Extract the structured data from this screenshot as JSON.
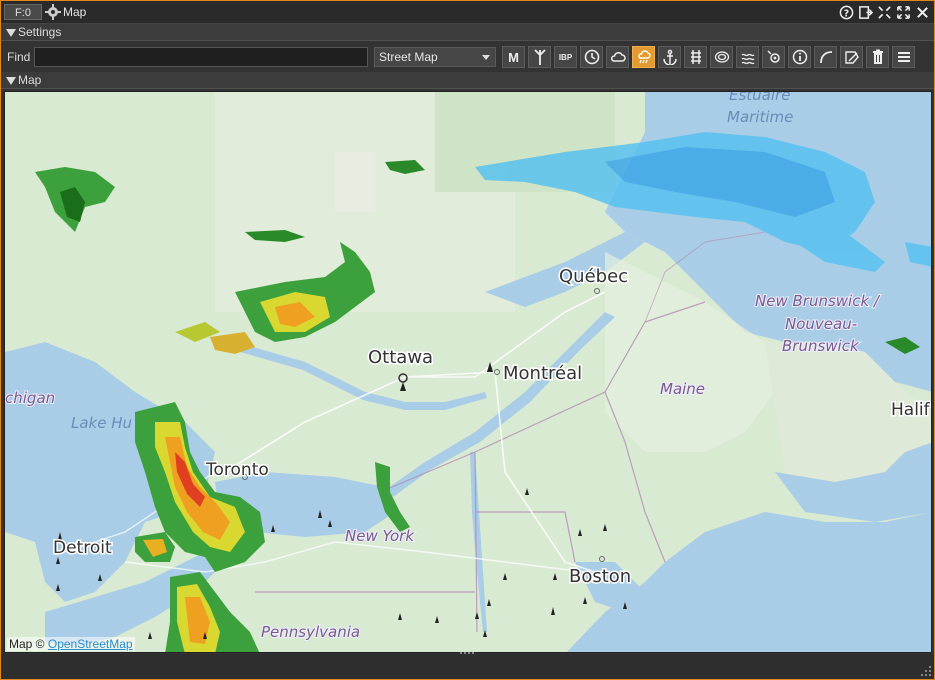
{
  "titlebar": {
    "badge": "F:0",
    "title": "Map"
  },
  "settings_section": {
    "label": "Settings"
  },
  "toolbar": {
    "find_label": "Find",
    "find_value": "",
    "map_style": "Street Map",
    "btn_m": "M",
    "btn_ibp": "IBP"
  },
  "map_section": {
    "label": "Map"
  },
  "map": {
    "cities": {
      "quebec": "Québec",
      "ottawa": "Ottawa",
      "montreal": "Montréal",
      "toronto": "Toronto",
      "detroit": "Detroit",
      "boston": "Boston",
      "halifax": "Halif"
    },
    "regions": {
      "nb1": "New Brunswick /",
      "nb2": "Nouveau-",
      "nb3": "Brunswick",
      "maine": "Maine",
      "newyork": "New York",
      "pennsylvania": "Pennsylvania",
      "michigan": "chigan"
    },
    "water": {
      "lakehuron": "Lake Hu",
      "estuaire": "Estuaire",
      "maritime": "Maritime"
    },
    "attribution_prefix": "Map © ",
    "attribution_link": "OpenStreetMap"
  },
  "colors": {
    "accent": "#e08a1e",
    "active_button": "#e39a2f"
  }
}
